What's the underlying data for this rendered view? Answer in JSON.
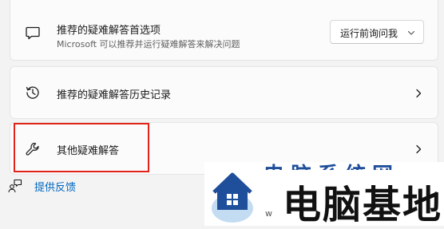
{
  "recommended": {
    "title": "推荐的疑难解答首选项",
    "subtitle": "Microsoft 可以推荐并运行疑难解答来解决问题",
    "dropdown_value": "运行前询问我"
  },
  "history": {
    "title": "推荐的疑难解答历史记录"
  },
  "other": {
    "title": "其他疑难解答"
  },
  "feedback": {
    "label": "提供反馈"
  },
  "watermark": {
    "brand": "电脑基地",
    "ghost": "电脑系统网",
    "small": "w"
  },
  "colors": {
    "accent": "#0067c0",
    "highlight": "#e2231a",
    "watermark_blue": "#1f4e9a"
  },
  "icons": {
    "recommended": "chat-bubble-icon",
    "history": "history-icon",
    "other": "wrench-icon",
    "feedback": "feedback-icon"
  }
}
